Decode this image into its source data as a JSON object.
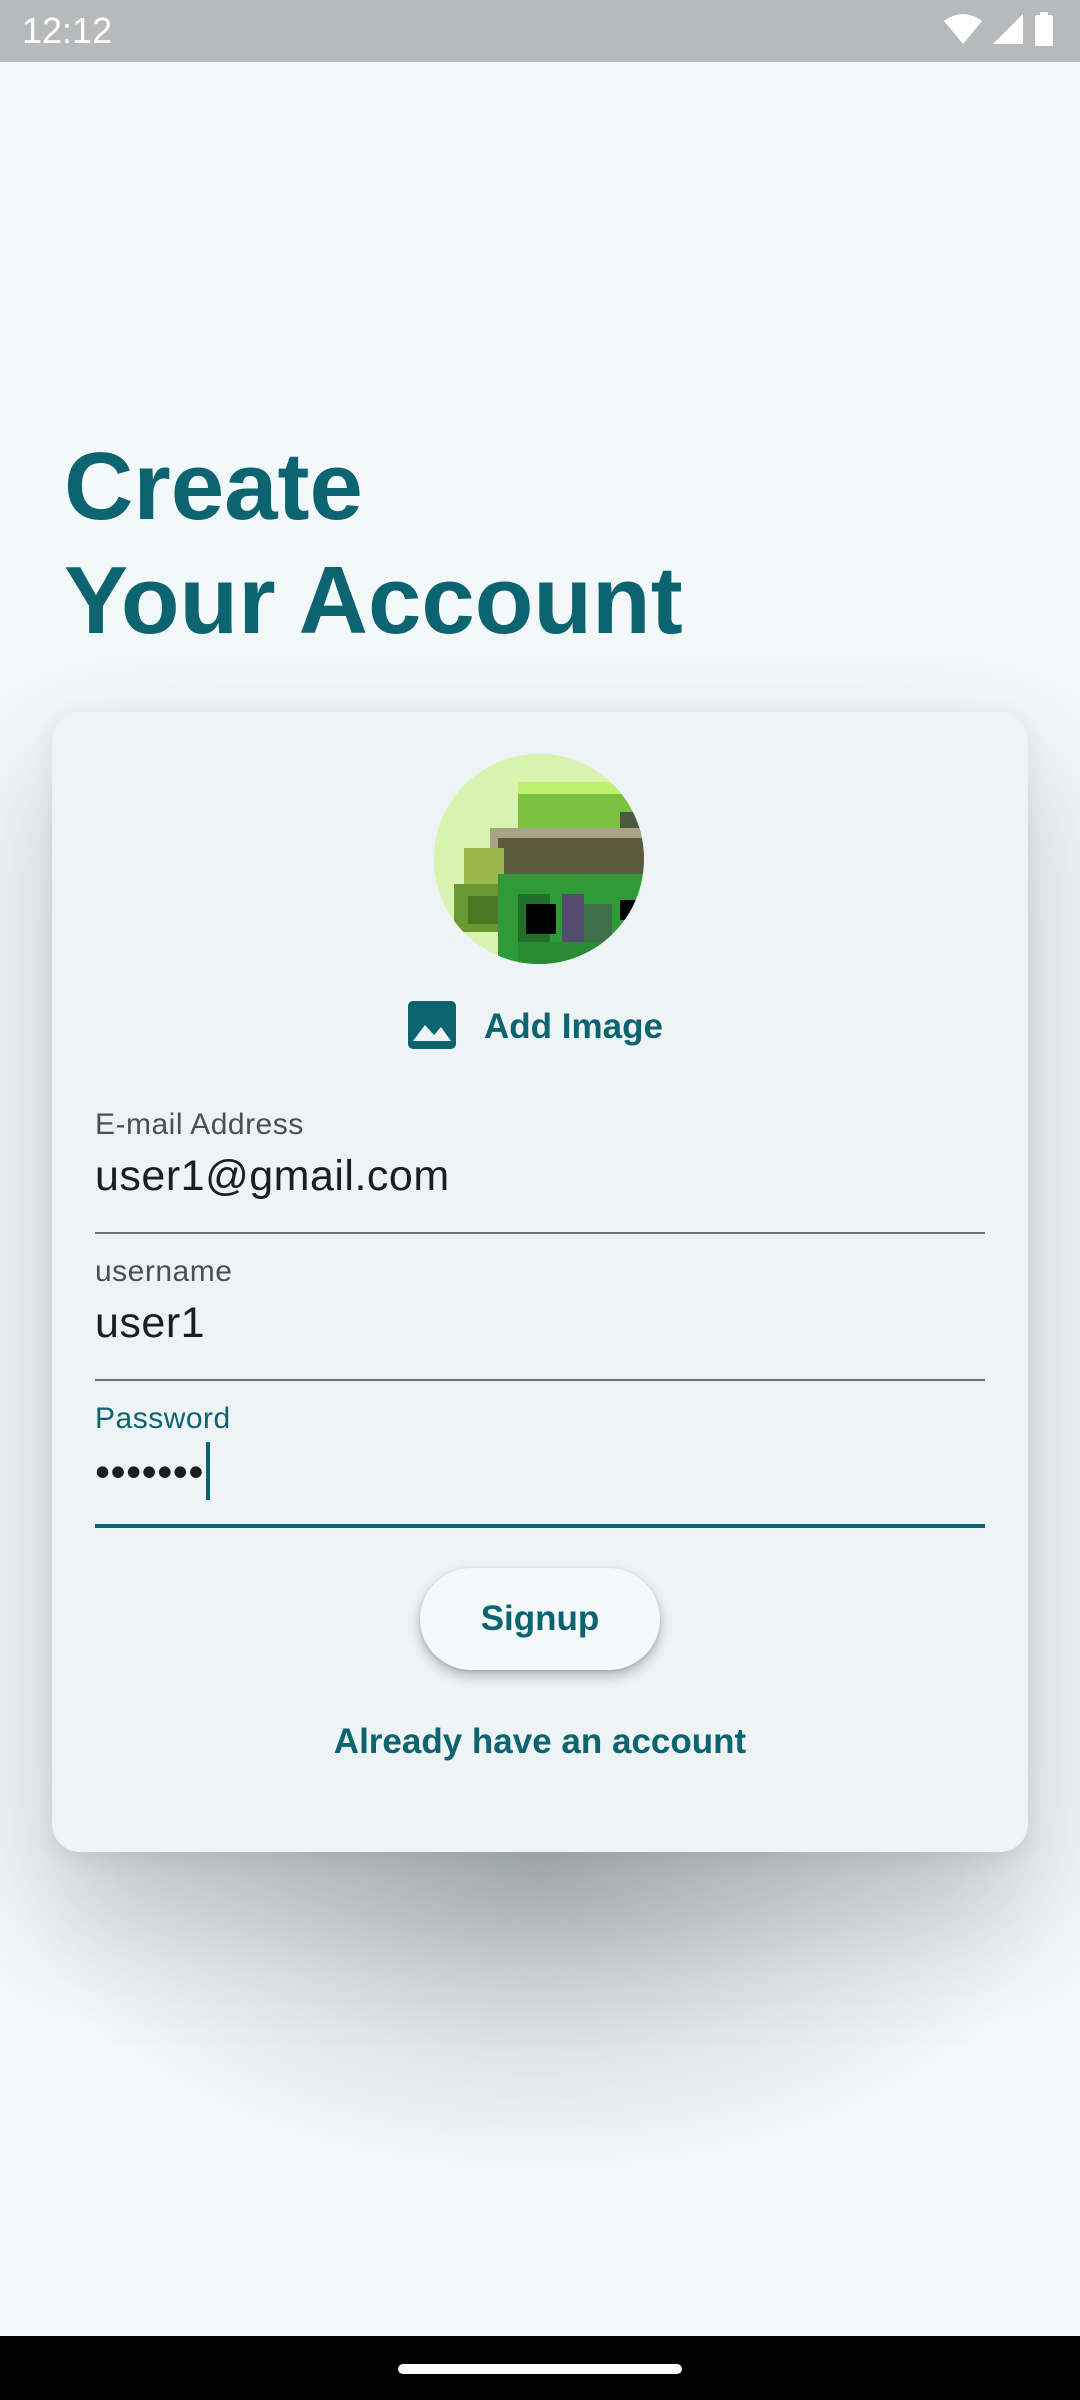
{
  "status_bar": {
    "time": "12:12",
    "icons": [
      "wifi-icon",
      "cellular-signal-icon",
      "battery-icon"
    ]
  },
  "header": {
    "title_line1": "Create",
    "title_line2": "Your Account"
  },
  "profile": {
    "avatar": "pixel-art-avatar",
    "add_image_icon": "image-icon",
    "add_image_label": "Add Image"
  },
  "form": {
    "email": {
      "label": "E-mail Address",
      "value": "user1@gmail.com"
    },
    "username": {
      "label": "username",
      "value": "user1"
    },
    "password": {
      "label": "Password",
      "value": "•••••••"
    }
  },
  "actions": {
    "signup_label": "Signup",
    "login_link_label": "Already have an account"
  },
  "colors": {
    "accent": "#0b6470",
    "background": "#f3f8f8",
    "card": "#eef3f5"
  }
}
